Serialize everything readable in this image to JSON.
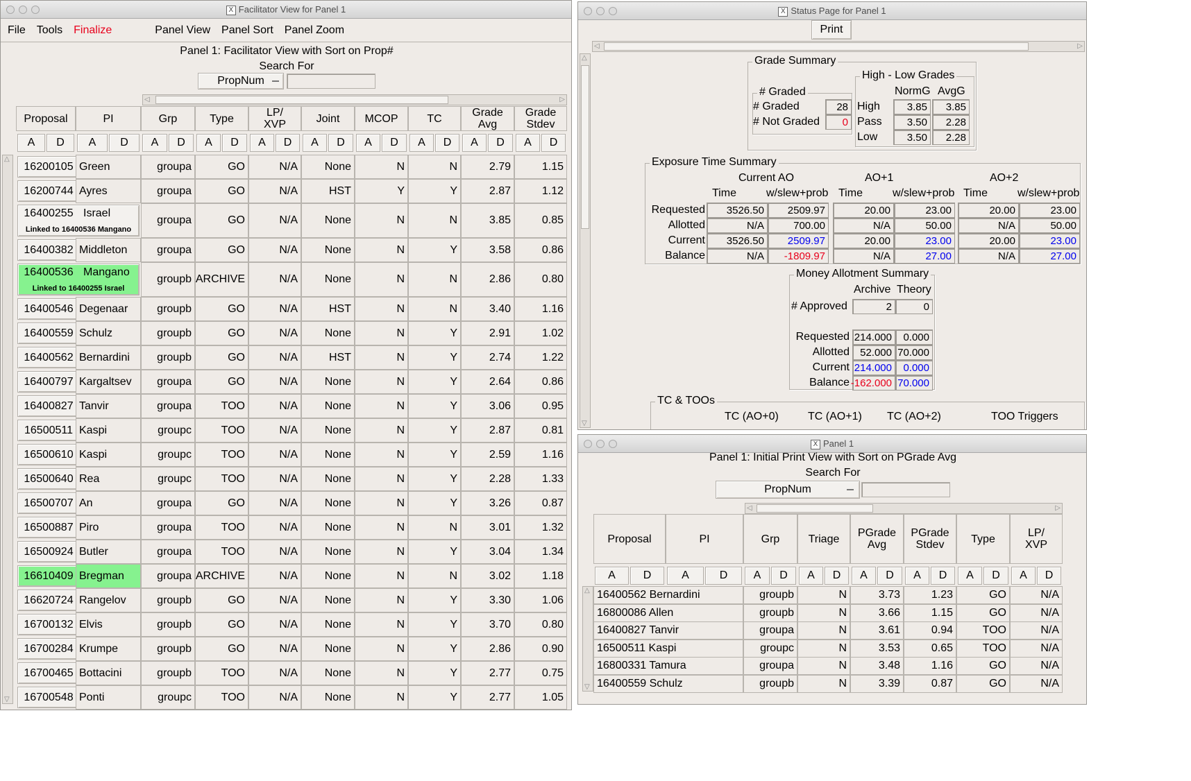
{
  "facilitator": {
    "window_title": "Facilitator View for Panel 1",
    "menu": {
      "file": "File",
      "tools": "Tools",
      "finalize": "Finalize",
      "panel_view": "Panel View",
      "panel_sort": "Panel Sort",
      "panel_zoom": "Panel Zoom"
    },
    "heading": "Panel 1: Facilitator View with Sort on Prop#",
    "search_label": "Search For",
    "search_field": "PropNum",
    "search_value": "",
    "columns": [
      "Proposal",
      "PI",
      "Grp",
      "Type",
      "LP/\nXVP",
      "Joint",
      "MCOP",
      "TC",
      "Grade\nAvg",
      "Grade\nStdev"
    ],
    "sort_a": "A",
    "sort_d": "D",
    "rows": [
      {
        "proposal": "16200105",
        "pi": "Green",
        "grp": "groupa",
        "type": "GO",
        "lp": "N/A",
        "joint": "None",
        "mcop": "N",
        "tc": "N",
        "avg": "2.79",
        "stdev": "1.15",
        "note": "",
        "highlight": false
      },
      {
        "proposal": "16200744",
        "pi": "Ayres",
        "grp": "groupa",
        "type": "GO",
        "lp": "N/A",
        "joint": "HST",
        "mcop": "Y",
        "tc": "Y",
        "avg": "2.87",
        "stdev": "1.12",
        "note": "",
        "highlight": false
      },
      {
        "proposal": "16400255",
        "pi": "Israel",
        "grp": "groupa",
        "type": "GO",
        "lp": "N/A",
        "joint": "None",
        "mcop": "N",
        "tc": "N",
        "avg": "3.85",
        "stdev": "0.85",
        "note": "Linked to 16400536 Mangano",
        "highlight": false
      },
      {
        "proposal": "16400382",
        "pi": "Middleton",
        "grp": "groupa",
        "type": "GO",
        "lp": "N/A",
        "joint": "None",
        "mcop": "N",
        "tc": "Y",
        "avg": "3.58",
        "stdev": "0.86",
        "note": "",
        "highlight": false
      },
      {
        "proposal": "16400536",
        "pi": "Mangano",
        "grp": "groupb",
        "type": "ARCHIVE",
        "lp": "N/A",
        "joint": "None",
        "mcop": "N",
        "tc": "N",
        "avg": "2.86",
        "stdev": "0.80",
        "note": "Linked to 16400255 Israel",
        "highlight": true
      },
      {
        "proposal": "16400546",
        "pi": "Degenaar",
        "grp": "groupb",
        "type": "GO",
        "lp": "N/A",
        "joint": "HST",
        "mcop": "N",
        "tc": "N",
        "avg": "3.40",
        "stdev": "1.16",
        "note": "",
        "highlight": false
      },
      {
        "proposal": "16400559",
        "pi": "Schulz",
        "grp": "groupb",
        "type": "GO",
        "lp": "N/A",
        "joint": "None",
        "mcop": "N",
        "tc": "Y",
        "avg": "2.91",
        "stdev": "1.02",
        "note": "",
        "highlight": false
      },
      {
        "proposal": "16400562",
        "pi": "Bernardini",
        "grp": "groupb",
        "type": "GO",
        "lp": "N/A",
        "joint": "HST",
        "mcop": "N",
        "tc": "Y",
        "avg": "2.74",
        "stdev": "1.22",
        "note": "",
        "highlight": false
      },
      {
        "proposal": "16400797",
        "pi": "Kargaltsev",
        "grp": "groupa",
        "type": "GO",
        "lp": "N/A",
        "joint": "None",
        "mcop": "N",
        "tc": "Y",
        "avg": "2.64",
        "stdev": "0.86",
        "note": "",
        "highlight": false
      },
      {
        "proposal": "16400827",
        "pi": "Tanvir",
        "grp": "groupa",
        "type": "TOO",
        "lp": "N/A",
        "joint": "None",
        "mcop": "N",
        "tc": "Y",
        "avg": "3.06",
        "stdev": "0.95",
        "note": "",
        "highlight": false
      },
      {
        "proposal": "16500511",
        "pi": "Kaspi",
        "grp": "groupc",
        "type": "TOO",
        "lp": "N/A",
        "joint": "None",
        "mcop": "N",
        "tc": "Y",
        "avg": "2.87",
        "stdev": "0.81",
        "note": "",
        "highlight": false
      },
      {
        "proposal": "16500610",
        "pi": "Kaspi",
        "grp": "groupc",
        "type": "TOO",
        "lp": "N/A",
        "joint": "None",
        "mcop": "N",
        "tc": "Y",
        "avg": "2.59",
        "stdev": "1.16",
        "note": "",
        "highlight": false
      },
      {
        "proposal": "16500640",
        "pi": "Rea",
        "grp": "groupc",
        "type": "TOO",
        "lp": "N/A",
        "joint": "None",
        "mcop": "N",
        "tc": "Y",
        "avg": "2.28",
        "stdev": "1.33",
        "note": "",
        "highlight": false
      },
      {
        "proposal": "16500707",
        "pi": "An",
        "grp": "groupa",
        "type": "GO",
        "lp": "N/A",
        "joint": "None",
        "mcop": "N",
        "tc": "Y",
        "avg": "3.26",
        "stdev": "0.87",
        "note": "",
        "highlight": false
      },
      {
        "proposal": "16500887",
        "pi": "Piro",
        "grp": "groupa",
        "type": "TOO",
        "lp": "N/A",
        "joint": "None",
        "mcop": "N",
        "tc": "N",
        "avg": "3.01",
        "stdev": "1.32",
        "note": "",
        "highlight": false
      },
      {
        "proposal": "16500924",
        "pi": "Butler",
        "grp": "groupa",
        "type": "TOO",
        "lp": "N/A",
        "joint": "None",
        "mcop": "N",
        "tc": "Y",
        "avg": "3.04",
        "stdev": "1.34",
        "note": "",
        "highlight": false
      },
      {
        "proposal": "16610409",
        "pi": "Bregman",
        "grp": "groupa",
        "type": "ARCHIVE",
        "lp": "N/A",
        "joint": "None",
        "mcop": "N",
        "tc": "N",
        "avg": "3.02",
        "stdev": "1.18",
        "note": "",
        "highlight": true
      },
      {
        "proposal": "16620724",
        "pi": "Rangelov",
        "grp": "groupb",
        "type": "GO",
        "lp": "N/A",
        "joint": "None",
        "mcop": "N",
        "tc": "Y",
        "avg": "3.30",
        "stdev": "1.06",
        "note": "",
        "highlight": false
      },
      {
        "proposal": "16700132",
        "pi": "Elvis",
        "grp": "groupb",
        "type": "GO",
        "lp": "N/A",
        "joint": "None",
        "mcop": "N",
        "tc": "Y",
        "avg": "3.70",
        "stdev": "0.80",
        "note": "",
        "highlight": false
      },
      {
        "proposal": "16700284",
        "pi": "Krumpe",
        "grp": "groupb",
        "type": "GO",
        "lp": "N/A",
        "joint": "None",
        "mcop": "N",
        "tc": "Y",
        "avg": "2.86",
        "stdev": "0.90",
        "note": "",
        "highlight": false
      },
      {
        "proposal": "16700465",
        "pi": "Bottacini",
        "grp": "groupb",
        "type": "TOO",
        "lp": "N/A",
        "joint": "None",
        "mcop": "N",
        "tc": "Y",
        "avg": "2.77",
        "stdev": "0.75",
        "note": "",
        "highlight": false
      },
      {
        "proposal": "16700548",
        "pi": "Ponti",
        "grp": "groupc",
        "type": "TOO",
        "lp": "N/A",
        "joint": "None",
        "mcop": "N",
        "tc": "Y",
        "avg": "2.77",
        "stdev": "1.05",
        "note": "",
        "highlight": false
      }
    ]
  },
  "status": {
    "window_title": "Status Page for Panel 1",
    "print_label": "Print",
    "grade_summary": {
      "title": "Grade Summary",
      "graded_group": "# Graded",
      "graded_label": "# Graded",
      "graded_value": "28",
      "not_graded_label": "# Not Graded",
      "not_graded_value": "0",
      "hl_group": "High - Low Grades",
      "col_normg": "NormG",
      "col_avgg": "AvgG",
      "rows": [
        {
          "label": "High",
          "normg": "3.85",
          "avgg": "3.85"
        },
        {
          "label": "Pass",
          "normg": "3.50",
          "avgg": "2.28"
        },
        {
          "label": "Low",
          "normg": "3.50",
          "avgg": "2.28"
        }
      ]
    },
    "exposure": {
      "title": "Exposure Time Summary",
      "groups": [
        "Current AO",
        "AO+1",
        "AO+2"
      ],
      "col_time": "Time",
      "col_slew": "w/slew+prob",
      "rows": [
        {
          "label": "Requested",
          "vals": [
            "3526.50",
            "2509.97",
            "20.00",
            "23.00",
            "20.00",
            "23.00"
          ],
          "colors": [
            "k",
            "k",
            "k",
            "k",
            "k",
            "k"
          ]
        },
        {
          "label": "Allotted",
          "vals": [
            "N/A",
            "700.00",
            "N/A",
            "50.00",
            "N/A",
            "50.00"
          ],
          "colors": [
            "k",
            "k",
            "k",
            "k",
            "k",
            "k"
          ]
        },
        {
          "label": "Current",
          "vals": [
            "3526.50",
            "2509.97",
            "20.00",
            "23.00",
            "20.00",
            "23.00"
          ],
          "colors": [
            "k",
            "b",
            "k",
            "b",
            "k",
            "b"
          ]
        },
        {
          "label": "Balance",
          "vals": [
            "N/A",
            "-1809.97",
            "N/A",
            "27.00",
            "N/A",
            "27.00"
          ],
          "colors": [
            "k",
            "r",
            "k",
            "b",
            "k",
            "b"
          ]
        }
      ]
    },
    "money": {
      "title": "Money Allotment Summary",
      "col_archive": "Archive",
      "col_theory": "Theory",
      "approved_label": "# Approved",
      "approved": [
        "2",
        "0"
      ],
      "rows": [
        {
          "label": "Requested",
          "vals": [
            "214.000",
            "0.000"
          ],
          "colors": [
            "k",
            "k"
          ]
        },
        {
          "label": "Allotted",
          "vals": [
            "52.000",
            "70.000"
          ],
          "colors": [
            "k",
            "k"
          ]
        },
        {
          "label": "Current",
          "vals": [
            "214.000",
            "0.000"
          ],
          "colors": [
            "b",
            "b"
          ]
        },
        {
          "label": "Balance",
          "vals": [
            "-162.000",
            "70.000"
          ],
          "colors": [
            "r",
            "b"
          ]
        }
      ]
    },
    "tc": {
      "title": "TC & TOOs",
      "cols": [
        "TC (AO+0)",
        "TC (AO+1)",
        "TC (AO+2)",
        "TOO Triggers"
      ]
    }
  },
  "panel1": {
    "window_title": "Panel 1",
    "heading": "Panel 1: Initial Print View with Sort on PGrade Avg",
    "search_label": "Search For",
    "search_field": "PropNum",
    "search_value": "",
    "columns": [
      "Proposal",
      "PI",
      "Grp",
      "Triage",
      "PGrade\nAvg",
      "PGrade\nStdev",
      "Type",
      "LP/\nXVP"
    ],
    "rows": [
      {
        "prop_pi": "16400562 Bernardini",
        "grp": "groupb",
        "triage": "N",
        "avg": "3.73",
        "stdev": "1.23",
        "type": "GO",
        "lp": "N/A"
      },
      {
        "prop_pi": "16800086 Allen",
        "grp": "groupb",
        "triage": "N",
        "avg": "3.66",
        "stdev": "1.15",
        "type": "GO",
        "lp": "N/A"
      },
      {
        "prop_pi": "16400827 Tanvir",
        "grp": "groupa",
        "triage": "N",
        "avg": "3.61",
        "stdev": "0.94",
        "type": "TOO",
        "lp": "N/A"
      },
      {
        "prop_pi": "16500511 Kaspi",
        "grp": "groupc",
        "triage": "N",
        "avg": "3.53",
        "stdev": "0.65",
        "type": "TOO",
        "lp": "N/A"
      },
      {
        "prop_pi": "16800331 Tamura",
        "grp": "groupa",
        "triage": "N",
        "avg": "3.48",
        "stdev": "1.16",
        "type": "GO",
        "lp": "N/A"
      },
      {
        "prop_pi": "16400559 Schulz",
        "grp": "groupb",
        "triage": "N",
        "avg": "3.39",
        "stdev": "0.87",
        "type": "GO",
        "lp": "N/A"
      }
    ]
  },
  "colors": {
    "highlight": "#86f28f",
    "red": "#e8001c",
    "blue": "#0000ee",
    "bg": "#efebe7"
  }
}
